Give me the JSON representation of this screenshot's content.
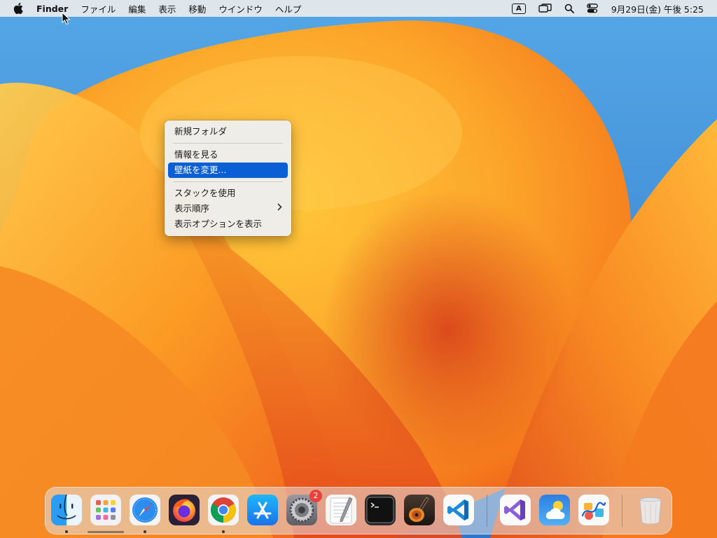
{
  "menubar": {
    "apple_icon": "apple-icon",
    "app_name": "Finder",
    "menus": [
      "ファイル",
      "編集",
      "表示",
      "移動",
      "ウインドウ",
      "ヘルプ"
    ],
    "input_method": "A",
    "status_icons": [
      "input-method-icon",
      "screen-mirroring-icon",
      "spotlight-search-icon",
      "control-center-icon"
    ],
    "clock": "9月29日(金)  午後 5:25"
  },
  "context_menu": {
    "items": [
      {
        "label": "新規フォルダ"
      },
      {
        "label": "情報を見る"
      },
      {
        "label": "壁紙を変更..."
      },
      {
        "label": "スタックを使用"
      },
      {
        "label": "表示順序"
      },
      {
        "label": "表示オプションを表示"
      }
    ],
    "highlighted_index": 2,
    "accent_color": "#0a5fd4"
  },
  "dock": {
    "apps": [
      {
        "name": "Finder",
        "icon": "finder-icon",
        "running": true
      },
      {
        "name": "Launchpad",
        "icon": "launchpad-icon",
        "running": false
      },
      {
        "name": "Safari",
        "icon": "safari-icon",
        "running": true
      },
      {
        "name": "Firefox",
        "icon": "firefox-icon",
        "running": false
      },
      {
        "name": "Google Chrome",
        "icon": "chrome-icon",
        "running": true
      },
      {
        "name": "App Store",
        "icon": "app-store-icon",
        "running": false
      },
      {
        "name": "System Settings",
        "icon": "system-settings-icon",
        "running": false,
        "badge": "2"
      },
      {
        "name": "TextEdit",
        "icon": "textedit-icon",
        "running": false
      },
      {
        "name": "Terminal",
        "icon": "terminal-icon",
        "running": false
      },
      {
        "name": "GarageBand",
        "icon": "garageband-icon",
        "running": false
      },
      {
        "name": "Visual Studio Code",
        "icon": "vscode-icon",
        "running": false
      },
      {
        "name": "Visual Studio",
        "icon": "visual-studio-icon",
        "running": false
      },
      {
        "name": "Weather",
        "icon": "weather-icon",
        "running": false
      },
      {
        "name": "Freeform",
        "icon": "freeform-icon",
        "running": false
      },
      {
        "name": "Trash",
        "icon": "trash-icon",
        "running": false
      }
    ]
  }
}
